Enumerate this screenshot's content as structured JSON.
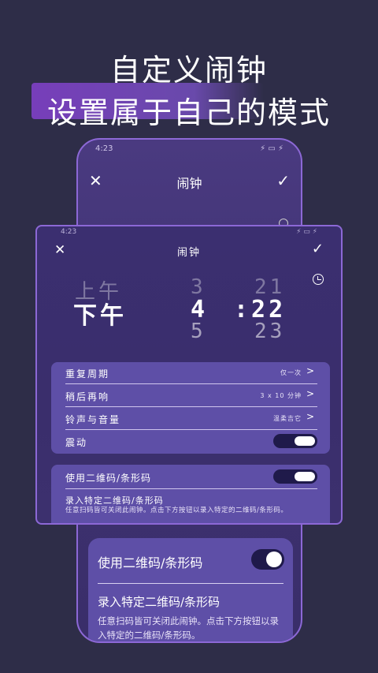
{
  "headline": {
    "line1": "自定义闹钟",
    "line2": "设置属于自己的模式"
  },
  "back_phone": {
    "status_time": "4:23",
    "status_icons": "⚡ ▭ ⚡",
    "title": "闹钟",
    "close_icon": "✕",
    "confirm_icon": "✓",
    "card": {
      "toggle_label": "使用二维码/条形码",
      "toggle_on": true,
      "record_title": "录入特定二维码/条形码",
      "record_desc": "任意扫码皆可关闭此闹钟。点击下方按钮以录入特定的二维码/条形码。"
    }
  },
  "front_phone": {
    "status_time": "4:23",
    "status_icons": "⚡ ▭ ⚡",
    "title": "闹钟",
    "close_icon": "✕",
    "confirm_icon": "✓",
    "picker": {
      "ampm_prev": "上午",
      "ampm_selected": "下午",
      "hour_prev": "3",
      "hour_selected": "4",
      "hour_next": "5",
      "minute_prev": "21",
      "minute_selected": ":22",
      "minute_next": "23"
    },
    "settings": [
      {
        "label": "重复周期",
        "value": "仅一次",
        "chevron": ">"
      },
      {
        "label": "稍后再响",
        "value": "3 x 10 分钟",
        "chevron": ">"
      },
      {
        "label": "铃声与音量",
        "value": "温柔吉它",
        "chevron": ">"
      },
      {
        "label": "震动",
        "toggle_on": true
      }
    ],
    "qr_card": {
      "toggle_label": "使用二维码/条形码",
      "toggle_on": true,
      "record_title": "录入特定二维码/条形码",
      "record_desc": "任意扫码皆可关闭此闹钟。点击下方按钮以录入特定的二维码/条形码。"
    }
  },
  "colors": {
    "background": "#2e2d48",
    "accent": "#8c68d6",
    "card": "#5e4fa7",
    "toggle_track": "#1f1a4a"
  }
}
